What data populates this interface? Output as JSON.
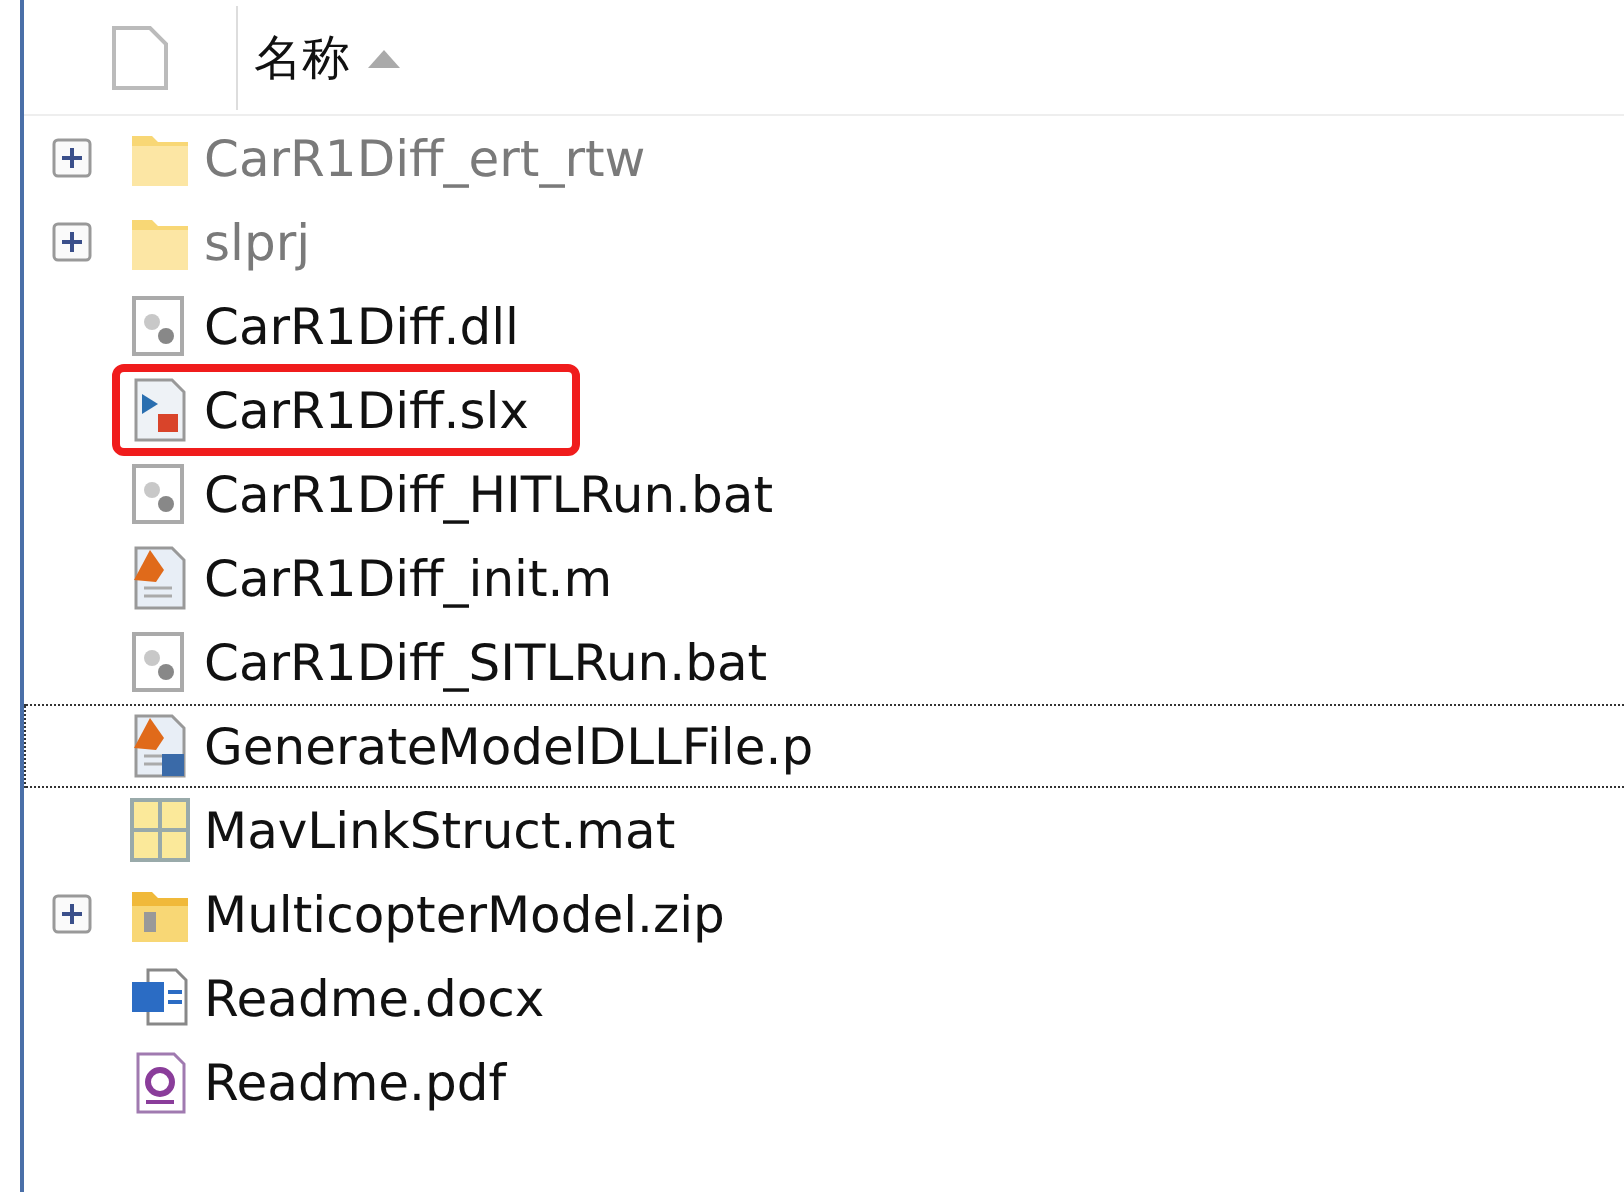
{
  "header": {
    "label": "名称",
    "sort_ascending": true
  },
  "files": [
    {
      "name": "CarR1Diff_ert_rtw",
      "kind": "folder",
      "expandable": true,
      "dimmed": true,
      "highlighted": false,
      "focused": false
    },
    {
      "name": "slprj",
      "kind": "folder",
      "expandable": true,
      "dimmed": true,
      "highlighted": false,
      "focused": false
    },
    {
      "name": "CarR1Diff.dll",
      "kind": "dll",
      "expandable": false,
      "dimmed": false,
      "highlighted": false,
      "focused": false
    },
    {
      "name": "CarR1Diff.slx",
      "kind": "slx",
      "expandable": false,
      "dimmed": false,
      "highlighted": true,
      "focused": false
    },
    {
      "name": "CarR1Diff_HITLRun.bat",
      "kind": "bat",
      "expandable": false,
      "dimmed": false,
      "highlighted": false,
      "focused": false
    },
    {
      "name": "CarR1Diff_init.m",
      "kind": "m",
      "expandable": false,
      "dimmed": false,
      "highlighted": false,
      "focused": false
    },
    {
      "name": "CarR1Diff_SITLRun.bat",
      "kind": "bat",
      "expandable": false,
      "dimmed": false,
      "highlighted": false,
      "focused": false
    },
    {
      "name": "GenerateModelDLLFile.p",
      "kind": "p",
      "expandable": false,
      "dimmed": false,
      "highlighted": false,
      "focused": true
    },
    {
      "name": "MavLinkStruct.mat",
      "kind": "mat",
      "expandable": false,
      "dimmed": false,
      "highlighted": false,
      "focused": false
    },
    {
      "name": "MulticopterModel.zip",
      "kind": "zip",
      "expandable": true,
      "dimmed": false,
      "highlighted": false,
      "focused": false
    },
    {
      "name": "Readme.docx",
      "kind": "docx",
      "expandable": false,
      "dimmed": false,
      "highlighted": false,
      "focused": false
    },
    {
      "name": "Readme.pdf",
      "kind": "pdf",
      "expandable": false,
      "dimmed": false,
      "highlighted": false,
      "focused": false
    }
  ]
}
